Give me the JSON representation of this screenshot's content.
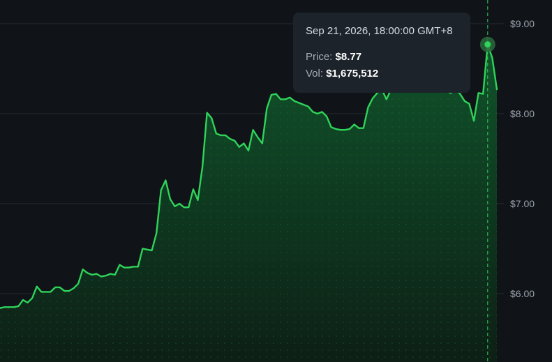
{
  "chart_data": {
    "type": "area",
    "y_ticks": [
      "$9.00",
      "$8.00",
      "$7.00",
      "$6.00"
    ],
    "y_tick_values": [
      9.0,
      8.0,
      7.0,
      6.0
    ],
    "ylim": [
      5.25,
      9.25
    ],
    "y_axis_side": "right",
    "grid": true,
    "series": [
      {
        "values": [
          5.84,
          5.85,
          5.85,
          5.85,
          5.86,
          5.93,
          5.9,
          5.95,
          6.08,
          6.02,
          6.02,
          6.02,
          6.07,
          6.07,
          6.03,
          6.03,
          6.06,
          6.11,
          6.27,
          6.23,
          6.21,
          6.22,
          6.19,
          6.2,
          6.22,
          6.21,
          6.32,
          6.29,
          6.29,
          6.3,
          6.3,
          6.5,
          6.49,
          6.48,
          6.67,
          7.15,
          7.26,
          7.05,
          6.97,
          7.0,
          6.96,
          6.96,
          7.16,
          7.04,
          7.41,
          8.01,
          7.95,
          7.78,
          7.76,
          7.76,
          7.72,
          7.7,
          7.63,
          7.67,
          7.59,
          7.82,
          7.74,
          7.67,
          8.06,
          8.21,
          8.22,
          8.16,
          8.16,
          8.18,
          8.14,
          8.12,
          8.1,
          8.08,
          8.02,
          8.0,
          8.02,
          7.97,
          7.85,
          7.83,
          7.82,
          7.82,
          7.83,
          7.88,
          7.84,
          7.84,
          8.07,
          8.17,
          8.23,
          8.27,
          8.16,
          8.27,
          8.4,
          8.48,
          8.52,
          8.47,
          8.4,
          8.35,
          8.3,
          8.28,
          8.25,
          8.26,
          8.24,
          8.25,
          8.23,
          8.27,
          8.22,
          8.14,
          8.11,
          7.92,
          8.23,
          8.22,
          8.77,
          8.62,
          8.27
        ]
      }
    ],
    "highlight_index": 106,
    "colors": {
      "line": "#2fd35a",
      "area_top": "#10532a",
      "area_bottom": "#0d1f16",
      "grid": "#252b32",
      "crosshair": "#2fd35a",
      "marker_halo": "#2a6a3c"
    }
  },
  "tooltip": {
    "time": "Sep 21, 2026, 18:00:00 GMT+8",
    "price_key": "Price:",
    "price_value": "$8.77",
    "vol_key": "Vol:",
    "vol_value": "$1,675,512"
  }
}
